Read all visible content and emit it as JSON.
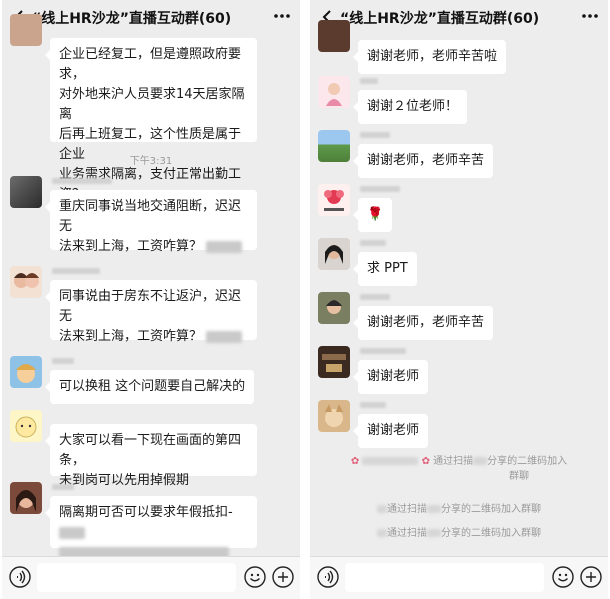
{
  "left": {
    "title": "“线上HR沙龙”直播互动群(60)",
    "first_bubble_lines": [
      "企业已经复工，但是遵照政府要求，",
      "对外地来沪人员要求14天居家隔离",
      "后再上班复工，这个性质是属于企业",
      "业务需求隔离，支付正常出勤工资？"
    ],
    "time": "下午3:31",
    "messages": [
      {
        "lines": [
          "重庆同事说当地交通阻断，迟迟无",
          "法来到上海，工资咋算？"
        ]
      },
      {
        "lines": [
          "同事说由于房东不让返沪，迟迟无",
          "法来到上海，工资咋算？"
        ]
      },
      {
        "lines": [
          "可以换租 这个问题要自己解决的"
        ]
      },
      {
        "lines": [
          "大家可以看一下现在画面的第四条，",
          "未到岗可以先用掉假期"
        ]
      },
      {
        "lines": [
          "隔离期可否可以要求年假抵扣-"
        ]
      }
    ]
  },
  "right": {
    "title": "“线上HR沙龙”直播互动群(60)",
    "messages": [
      {
        "text": "谢谢老师，老师辛苦啦"
      },
      {
        "text": "谢谢２位老师！"
      },
      {
        "text": "谢谢老师，老师辛苦"
      },
      {
        "text": "🌹"
      },
      {
        "text": "求 PPT"
      },
      {
        "text": "谢谢老师，老师辛苦"
      },
      {
        "text": "谢谢老师"
      },
      {
        "text": "谢谢老师"
      }
    ],
    "system": [
      {
        "pre": "",
        "mid": "通过扫描",
        "post": "分享的二维码加入",
        "line2": "群聊"
      },
      {
        "pre": "",
        "mid": "通过扫描",
        "post": "分享的二维码加入群聊"
      },
      {
        "pre": "",
        "mid": "通过扫描",
        "post": "分享的二维码加入群聊"
      }
    ]
  },
  "icons": {
    "back": "chevron-left-icon",
    "more": "more-dots-icon",
    "voice": "voice-icon",
    "emoji": "emoji-icon",
    "plus": "plus-icon"
  },
  "colors": {
    "background": "#ededed",
    "bubble": "#ffffff",
    "footer": "#f7f7f7"
  }
}
